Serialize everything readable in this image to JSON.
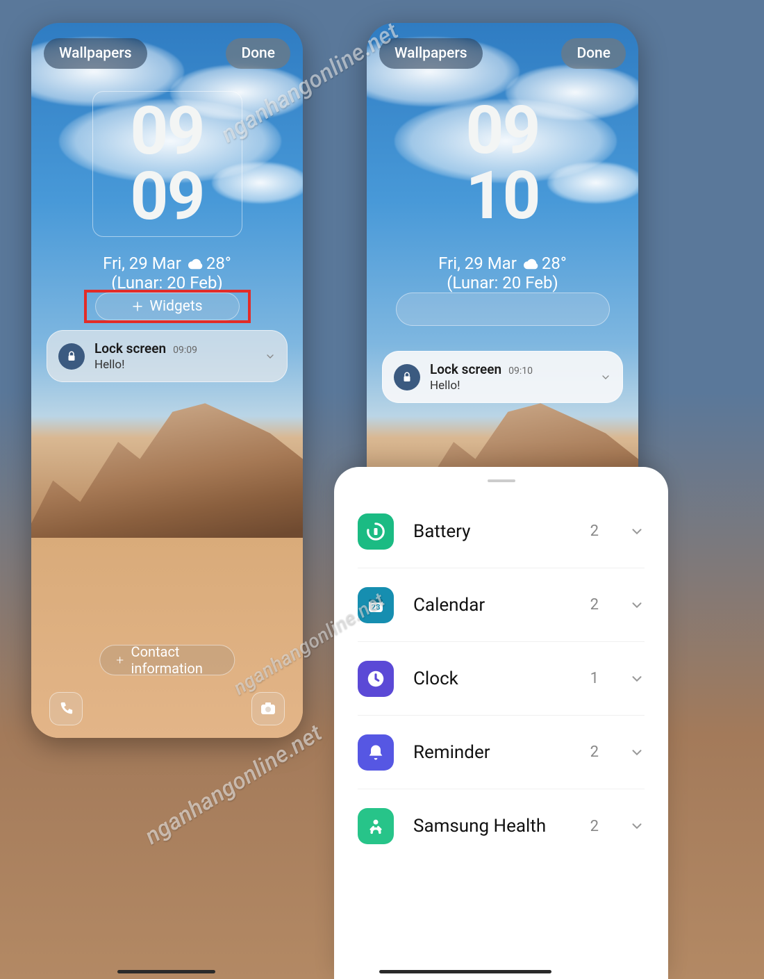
{
  "watermark": "nganhangonline.net",
  "left": {
    "wallpapers_btn": "Wallpapers",
    "done_btn": "Done",
    "clock_hh": "09",
    "clock_mm": "09",
    "date": "Fri, 29 Mar",
    "temp": "28°",
    "lunar": "(Lunar: 20 Feb)",
    "widgets_btn": "Widgets",
    "notif": {
      "title": "Lock screen",
      "time": "09:09",
      "msg": "Hello!"
    },
    "contact_btn": "Contact information"
  },
  "right": {
    "wallpapers_btn": "Wallpapers",
    "done_btn": "Done",
    "clock_hh": "09",
    "clock_mm": "10",
    "date": "Fri, 29 Mar",
    "temp": "28°",
    "lunar": "(Lunar: 20 Feb)",
    "notif": {
      "title": "Lock screen",
      "time": "09:10",
      "msg": "Hello!"
    }
  },
  "sheet": {
    "items": [
      {
        "label": "Battery",
        "count": "2"
      },
      {
        "label": "Calendar",
        "count": "2"
      },
      {
        "label": "Clock",
        "count": "1"
      },
      {
        "label": "Reminder",
        "count": "2"
      },
      {
        "label": "Samsung Health",
        "count": "2"
      }
    ]
  }
}
